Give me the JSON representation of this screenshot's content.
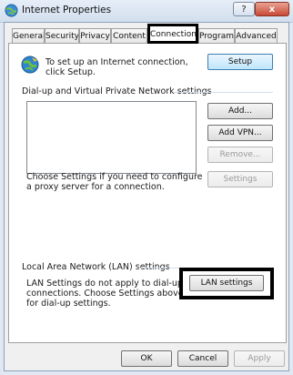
{
  "window": {
    "title": "Internet Properties",
    "help_label": "?",
    "close_label": "x"
  },
  "tabs": [
    {
      "label": "General",
      "active": false
    },
    {
      "label": "Security",
      "active": false
    },
    {
      "label": "Privacy",
      "active": false
    },
    {
      "label": "Content",
      "active": false
    },
    {
      "label": "Connections",
      "active": true
    },
    {
      "label": "Programs",
      "active": false
    },
    {
      "label": "Advanced",
      "active": false
    }
  ],
  "setup": {
    "text": "To set up an Internet connection, click Setup.",
    "button": "Setup"
  },
  "dialup": {
    "heading": "Dial-up and Virtual Private Network settings",
    "add_button": "Add...",
    "add_vpn_button": "Add VPN...",
    "remove_button": "Remove...",
    "settings_text": "Choose Settings if you need to configure a proxy server for a connection.",
    "settings_button": "Settings"
  },
  "lan": {
    "heading": "Local Area Network (LAN) settings",
    "text": "LAN Settings do not apply to dial-up connections. Choose Settings above for dial-up settings.",
    "button": "LAN settings"
  },
  "footer": {
    "ok": "OK",
    "cancel": "Cancel",
    "apply": "Apply"
  },
  "colors": {
    "highlight": "#000000",
    "setup_button": "#bee6fd"
  }
}
